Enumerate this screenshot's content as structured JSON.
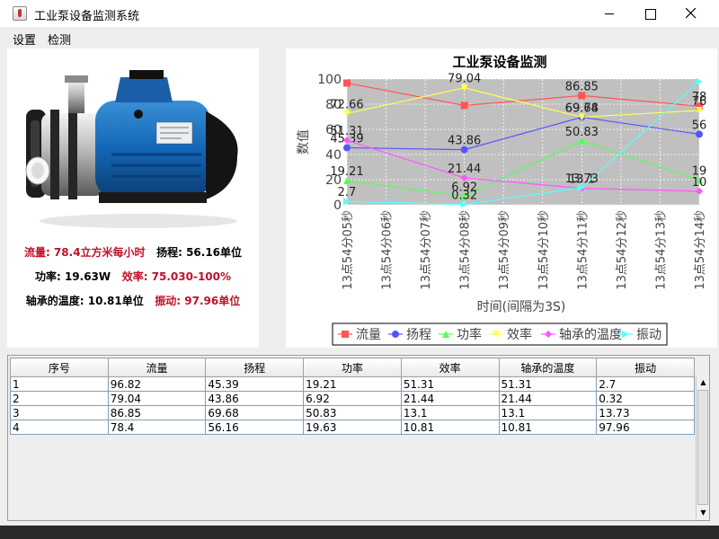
{
  "window": {
    "title": "工业泵设备监测系统"
  },
  "menu": [
    "设置",
    "检测"
  ],
  "status": {
    "flow": "流量: 78.4立方米每小时",
    "head": "扬程: 56.16单位",
    "power": "功率: 19.63W",
    "efficiency": "效率: 75.030-100%",
    "bearing_temp": "轴承的温度: 10.81单位",
    "vibration": "振动: 97.96单位"
  },
  "chart_data": {
    "type": "line",
    "title": "工业泵设备监测",
    "xlabel": "时间(间隔为3S)",
    "ylabel": "数值",
    "ylim": [
      0,
      100
    ],
    "yticks": [
      0,
      20,
      40,
      60,
      80,
      100
    ],
    "grid": true,
    "legend_position": "bottom",
    "categories": [
      "13点54分05秒",
      "13点54分06秒",
      "13点54分07秒",
      "13点54分08秒",
      "13点54分09秒",
      "13点54分10秒",
      "13点54分11秒",
      "13点54分12秒",
      "13点54分13秒",
      "13点54分14秒"
    ],
    "series": [
      {
        "name": "流量",
        "color": "#ff5555",
        "marker": "square",
        "x": [
          0,
          3,
          6,
          9
        ],
        "values": [
          96.82,
          79.04,
          86.85,
          78.4
        ],
        "labels": [
          "",
          "",
          "86.85",
          "78"
        ]
      },
      {
        "name": "扬程",
        "color": "#5555ff",
        "marker": "circle",
        "x": [
          0,
          3,
          6,
          9
        ],
        "values": [
          45.39,
          43.86,
          69.68,
          56.16
        ],
        "labels": [
          "45.39",
          "43.86",
          "69.74",
          "56"
        ]
      },
      {
        "name": "功率",
        "color": "#55ff55",
        "marker": "triangle",
        "x": [
          0,
          3,
          6,
          9
        ],
        "values": [
          19.21,
          6.92,
          50.83,
          19.63
        ],
        "labels": [
          "19.21",
          "6.92",
          "50.83",
          "19"
        ]
      },
      {
        "name": "效率",
        "color": "#ffff55",
        "marker": "triangle-down",
        "x": [
          0,
          3,
          6,
          9
        ],
        "values": [
          72.66,
          93.04,
          69.68,
          75.03
        ],
        "labels": [
          "72.66",
          "79.04",
          "69.68",
          "76"
        ]
      },
      {
        "name": "轴承的温度",
        "color": "#ff55ff",
        "marker": "diamond",
        "x": [
          0,
          3,
          6,
          9
        ],
        "values": [
          51.31,
          21.44,
          13.1,
          10.81
        ],
        "labels": [
          "51.31",
          "21.44",
          "13.1",
          "10"
        ]
      },
      {
        "name": "振动",
        "color": "#55ffff",
        "marker": "triangle-side",
        "x": [
          0,
          3,
          6,
          9
        ],
        "values": [
          2.7,
          0.32,
          13.73,
          97.96
        ],
        "labels": [
          "2.7",
          "0.32",
          "13.73",
          ""
        ]
      }
    ]
  },
  "table": {
    "headers": [
      "序号",
      "流量",
      "扬程",
      "功率",
      "效率",
      "轴承的温度",
      "振动"
    ],
    "rows": [
      [
        "1",
        "96.82",
        "45.39",
        "19.21",
        "51.31",
        "51.31",
        "2.7"
      ],
      [
        "2",
        "79.04",
        "43.86",
        "6.92",
        "21.44",
        "21.44",
        "0.32"
      ],
      [
        "3",
        "86.85",
        "69.68",
        "50.83",
        "13.1",
        "13.1",
        "13.73"
      ],
      [
        "4",
        "78.4",
        "56.16",
        "19.63",
        "10.81",
        "10.81",
        "97.96"
      ]
    ]
  }
}
